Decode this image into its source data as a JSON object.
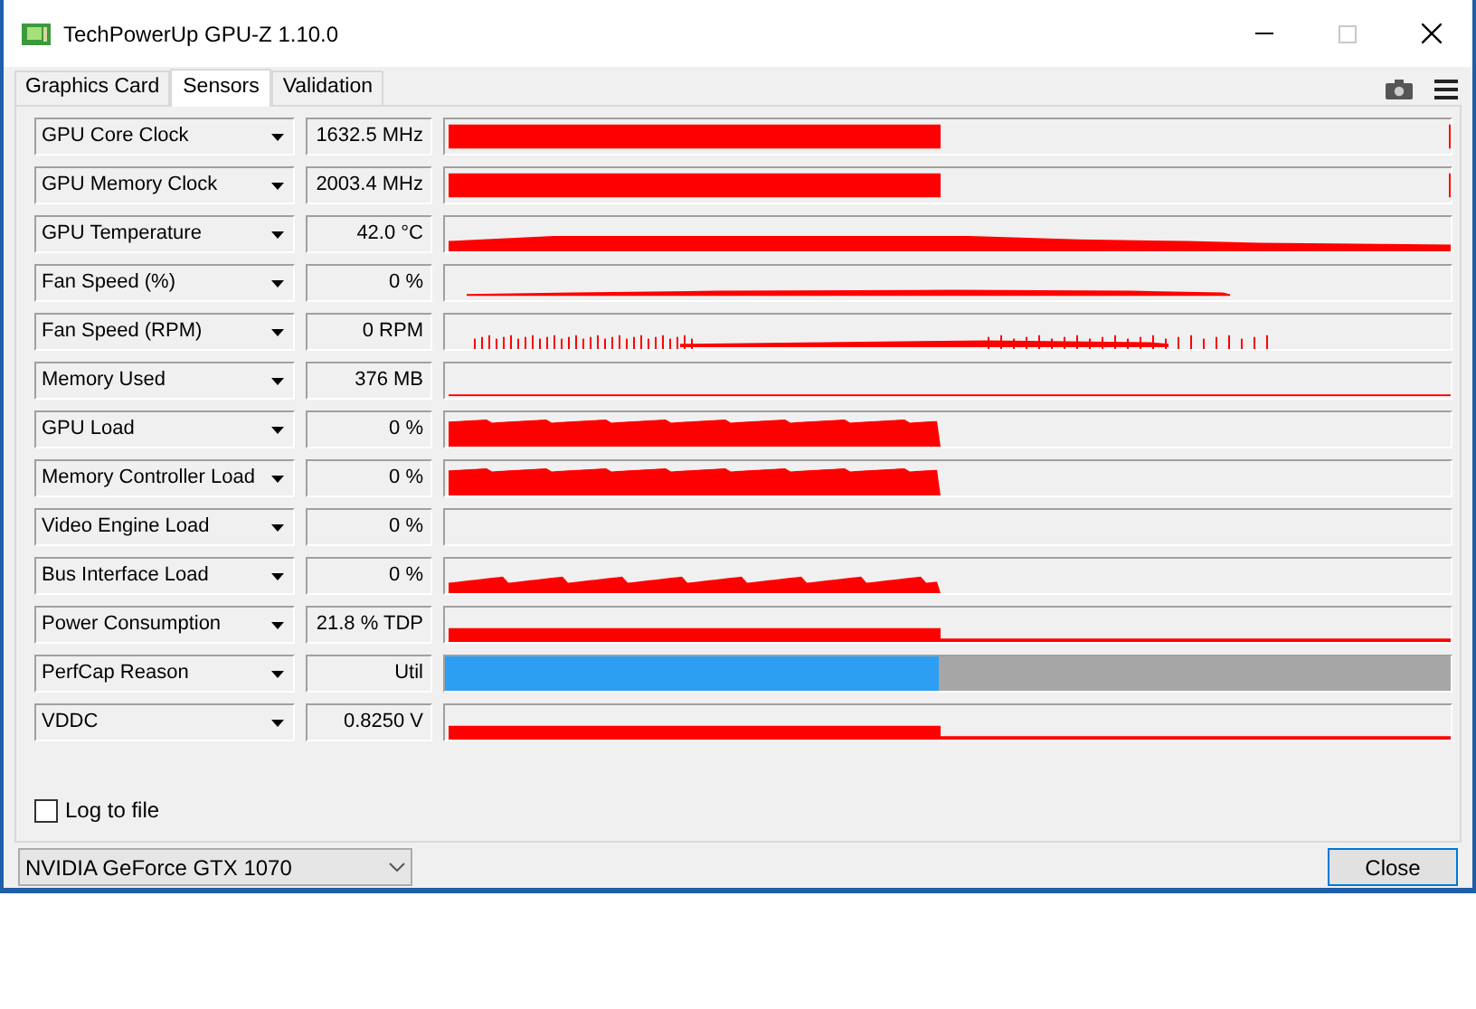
{
  "window": {
    "title": "TechPowerUp GPU-Z 1.10.0"
  },
  "tabs": [
    {
      "label": "Graphics Card",
      "selected": false
    },
    {
      "label": "Sensors",
      "selected": true
    },
    {
      "label": "Validation",
      "selected": false
    }
  ],
  "sensors": [
    {
      "name": "GPU Core Clock",
      "value": "1632.5 MHz",
      "kind": "block"
    },
    {
      "name": "GPU Memory Clock",
      "value": "2003.4 MHz",
      "kind": "block"
    },
    {
      "name": "GPU Temperature",
      "value": "42.0 °C",
      "kind": "hill"
    },
    {
      "name": "Fan Speed (%)",
      "value": "0 %",
      "kind": "thinhill"
    },
    {
      "name": "Fan Speed (RPM)",
      "value": "0 RPM",
      "kind": "spikes"
    },
    {
      "name": "Memory Used",
      "value": "376 MB",
      "kind": "baseline"
    },
    {
      "name": "GPU Load",
      "value": "0 %",
      "kind": "noisyblock"
    },
    {
      "name": "Memory Controller Load",
      "value": "0 %",
      "kind": "noisyblock"
    },
    {
      "name": "Video Engine Load",
      "value": "0 %",
      "kind": "empty"
    },
    {
      "name": "Bus Interface Load",
      "value": "0 %",
      "kind": "noise"
    },
    {
      "name": "Power Consumption",
      "value": "21.8 % TDP",
      "kind": "step"
    },
    {
      "name": "PerfCap Reason",
      "value": "Util",
      "kind": "split"
    },
    {
      "name": "VDDC",
      "value": "0.8250 V",
      "kind": "step"
    }
  ],
  "log_to_file": {
    "label": "Log to file",
    "checked": false
  },
  "gpu_select": {
    "value": "NVIDIA GeForce GTX 1070"
  },
  "close_button": {
    "label": "Close"
  }
}
